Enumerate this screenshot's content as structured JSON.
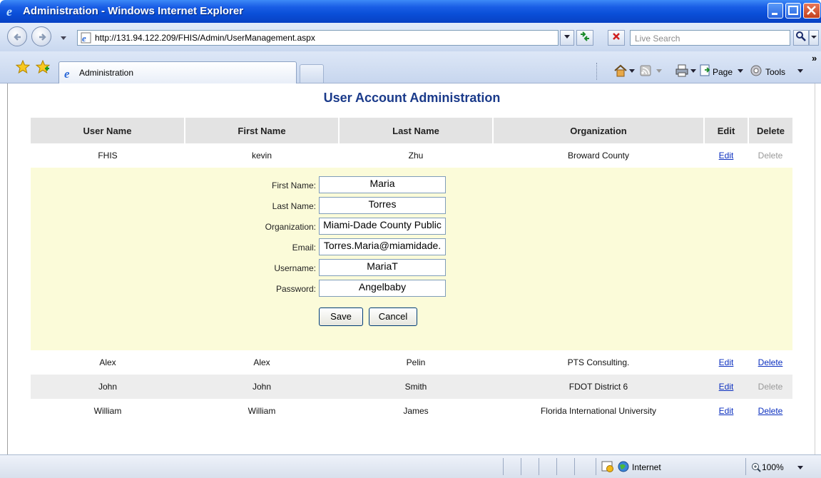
{
  "window": {
    "title": "Administration - Windows Internet Explorer"
  },
  "address": {
    "url": "http://131.94.122.209/FHIS/Admin/UserManagement.aspx"
  },
  "search": {
    "placeholder": "Live Search"
  },
  "tabs": [
    {
      "label": "Administration"
    }
  ],
  "commandbar": {
    "page_label": "Page",
    "tools_label": "Tools"
  },
  "page": {
    "heading": "User Account Administration"
  },
  "table": {
    "columns": [
      "User Name",
      "First Name",
      "Last Name",
      "Organization",
      "Edit",
      "Delete"
    ],
    "rows": [
      {
        "username": "FHIS",
        "first": "kevin",
        "last": "Zhu",
        "org": "Broward County",
        "edit": "Edit",
        "delete": "Delete",
        "delete_enabled": false
      },
      {
        "username": "Alex",
        "first": "Alex",
        "last": "Pelin",
        "org": "PTS Consulting.",
        "edit": "Edit",
        "delete": "Delete",
        "delete_enabled": true
      },
      {
        "username": "John",
        "first": "John",
        "last": "Smith",
        "org": "FDOT District 6",
        "edit": "Edit",
        "delete": "Delete",
        "delete_enabled": false
      },
      {
        "username": "William",
        "first": "William",
        "last": "James",
        "org": "Florida International University",
        "edit": "Edit",
        "delete": "Delete",
        "delete_enabled": true
      }
    ]
  },
  "edit_form": {
    "fields": [
      {
        "label": "First Name:",
        "value": "Maria"
      },
      {
        "label": "Last Name:",
        "value": "Torres"
      },
      {
        "label": "Organization:",
        "value": "Miami-Dade County Public"
      },
      {
        "label": "Email:",
        "value": "Torres.Maria@miamidade."
      },
      {
        "label": "Username:",
        "value": "MariaT"
      },
      {
        "label": "Password:",
        "value": "Angelbaby"
      }
    ],
    "save_label": "Save",
    "cancel_label": "Cancel"
  },
  "statusbar": {
    "zone": "Internet",
    "zoom": "100%"
  }
}
